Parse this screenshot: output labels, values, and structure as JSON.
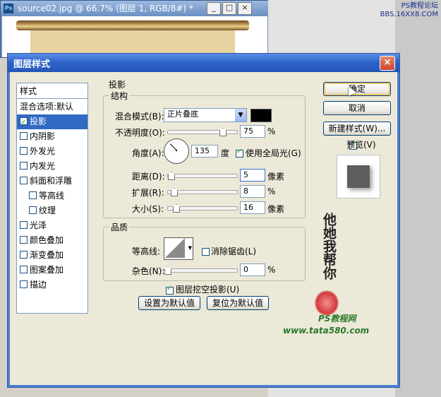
{
  "document_window": {
    "title": "source02.jpg @ 66.7% (图层 1, RGB/8#) *",
    "buttons": [
      "_",
      "□",
      "×"
    ]
  },
  "watermark_top": {
    "line1": "PS教程论坛",
    "line2": "BBS.16XX8.COM"
  },
  "dialog": {
    "title": "图层样式",
    "close_label": "×",
    "style_list": {
      "header": "样式",
      "items": [
        {
          "label": "混合选项:默认",
          "checkbox": false,
          "checked": false,
          "selected": false,
          "indent": 0
        },
        {
          "label": "投影",
          "checkbox": true,
          "checked": true,
          "selected": true,
          "indent": 0
        },
        {
          "label": "内阴影",
          "checkbox": true,
          "checked": false,
          "selected": false,
          "indent": 0
        },
        {
          "label": "外发光",
          "checkbox": true,
          "checked": false,
          "selected": false,
          "indent": 0
        },
        {
          "label": "内发光",
          "checkbox": true,
          "checked": false,
          "selected": false,
          "indent": 0
        },
        {
          "label": "斜面和浮雕",
          "checkbox": true,
          "checked": false,
          "selected": false,
          "indent": 0
        },
        {
          "label": "等高线",
          "checkbox": true,
          "checked": false,
          "selected": false,
          "indent": 1
        },
        {
          "label": "纹理",
          "checkbox": true,
          "checked": false,
          "selected": false,
          "indent": 1
        },
        {
          "label": "光泽",
          "checkbox": true,
          "checked": false,
          "selected": false,
          "indent": 0
        },
        {
          "label": "颜色叠加",
          "checkbox": true,
          "checked": false,
          "selected": false,
          "indent": 0
        },
        {
          "label": "渐变叠加",
          "checkbox": true,
          "checked": false,
          "selected": false,
          "indent": 0
        },
        {
          "label": "图案叠加",
          "checkbox": true,
          "checked": false,
          "selected": false,
          "indent": 0
        },
        {
          "label": "描边",
          "checkbox": true,
          "checked": false,
          "selected": false,
          "indent": 0
        }
      ]
    },
    "section_title": "投影",
    "structure": {
      "legend": "结构",
      "blend_mode_label": "混合模式(B):",
      "blend_mode_value": "正片叠底",
      "shadow_color": "#000000",
      "opacity_label": "不透明度(O):",
      "opacity_value": "75",
      "opacity_unit": "%",
      "opacity_level": 0.75,
      "angle_label": "角度(A):",
      "angle_value": "135",
      "angle_unit": "度",
      "global_light_label": "使用全局光(G)",
      "global_light_checked": true,
      "distance_label": "距离(D):",
      "distance_value": "5",
      "distance_unit": "像素",
      "spread_label": "扩展(R):",
      "spread_value": "8",
      "spread_unit": "%",
      "size_label": "大小(S):",
      "size_value": "16",
      "size_unit": "像素"
    },
    "quality": {
      "legend": "品质",
      "contour_label": "等高线:",
      "anti_alias_label": "消除锯齿(L)",
      "anti_alias_checked": false,
      "noise_label": "杂色(N):",
      "noise_value": "0",
      "noise_unit": "%"
    },
    "knockout_label": "图层挖空投影(U)",
    "knockout_checked": true,
    "make_default_label": "设置为默认值",
    "reset_default_label": "复位为默认值",
    "ok_label": "确定",
    "cancel_label": "取消",
    "new_style_label": "新建样式(W)...",
    "preview_label": "预览(V)",
    "preview_checked": true
  },
  "watermark_bottom": {
    "calligraphy": "他她我帮你",
    "site_name": "PS教程网",
    "url": "www.tata580.com"
  },
  "colors": {
    "titlebar": "#2b62c8",
    "selection": "#316ac5",
    "dialog_bg": "#ece9d8",
    "seal_red": "#d43a3a",
    "watermark_green": "#2a7a2a"
  }
}
